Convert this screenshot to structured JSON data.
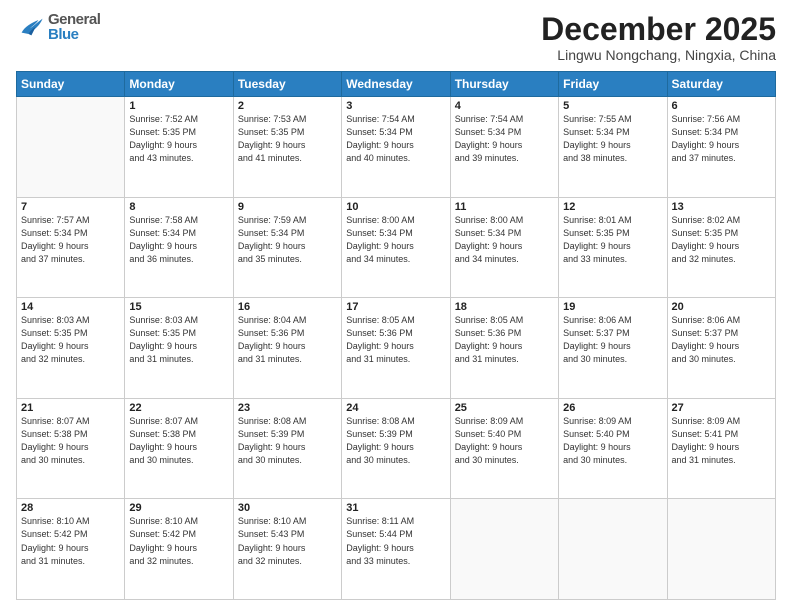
{
  "header": {
    "logo_line1": "General",
    "logo_line2": "Blue",
    "month_title": "December 2025",
    "location": "Lingwu Nongchang, Ningxia, China"
  },
  "calendar": {
    "weekdays": [
      "Sunday",
      "Monday",
      "Tuesday",
      "Wednesday",
      "Thursday",
      "Friday",
      "Saturday"
    ],
    "weeks": [
      [
        {
          "day": "",
          "info": ""
        },
        {
          "day": "1",
          "info": "Sunrise: 7:52 AM\nSunset: 5:35 PM\nDaylight: 9 hours\nand 43 minutes."
        },
        {
          "day": "2",
          "info": "Sunrise: 7:53 AM\nSunset: 5:35 PM\nDaylight: 9 hours\nand 41 minutes."
        },
        {
          "day": "3",
          "info": "Sunrise: 7:54 AM\nSunset: 5:34 PM\nDaylight: 9 hours\nand 40 minutes."
        },
        {
          "day": "4",
          "info": "Sunrise: 7:54 AM\nSunset: 5:34 PM\nDaylight: 9 hours\nand 39 minutes."
        },
        {
          "day": "5",
          "info": "Sunrise: 7:55 AM\nSunset: 5:34 PM\nDaylight: 9 hours\nand 38 minutes."
        },
        {
          "day": "6",
          "info": "Sunrise: 7:56 AM\nSunset: 5:34 PM\nDaylight: 9 hours\nand 37 minutes."
        }
      ],
      [
        {
          "day": "7",
          "info": "Sunrise: 7:57 AM\nSunset: 5:34 PM\nDaylight: 9 hours\nand 37 minutes."
        },
        {
          "day": "8",
          "info": "Sunrise: 7:58 AM\nSunset: 5:34 PM\nDaylight: 9 hours\nand 36 minutes."
        },
        {
          "day": "9",
          "info": "Sunrise: 7:59 AM\nSunset: 5:34 PM\nDaylight: 9 hours\nand 35 minutes."
        },
        {
          "day": "10",
          "info": "Sunrise: 8:00 AM\nSunset: 5:34 PM\nDaylight: 9 hours\nand 34 minutes."
        },
        {
          "day": "11",
          "info": "Sunrise: 8:00 AM\nSunset: 5:34 PM\nDaylight: 9 hours\nand 34 minutes."
        },
        {
          "day": "12",
          "info": "Sunrise: 8:01 AM\nSunset: 5:35 PM\nDaylight: 9 hours\nand 33 minutes."
        },
        {
          "day": "13",
          "info": "Sunrise: 8:02 AM\nSunset: 5:35 PM\nDaylight: 9 hours\nand 32 minutes."
        }
      ],
      [
        {
          "day": "14",
          "info": "Sunrise: 8:03 AM\nSunset: 5:35 PM\nDaylight: 9 hours\nand 32 minutes."
        },
        {
          "day": "15",
          "info": "Sunrise: 8:03 AM\nSunset: 5:35 PM\nDaylight: 9 hours\nand 31 minutes."
        },
        {
          "day": "16",
          "info": "Sunrise: 8:04 AM\nSunset: 5:36 PM\nDaylight: 9 hours\nand 31 minutes."
        },
        {
          "day": "17",
          "info": "Sunrise: 8:05 AM\nSunset: 5:36 PM\nDaylight: 9 hours\nand 31 minutes."
        },
        {
          "day": "18",
          "info": "Sunrise: 8:05 AM\nSunset: 5:36 PM\nDaylight: 9 hours\nand 31 minutes."
        },
        {
          "day": "19",
          "info": "Sunrise: 8:06 AM\nSunset: 5:37 PM\nDaylight: 9 hours\nand 30 minutes."
        },
        {
          "day": "20",
          "info": "Sunrise: 8:06 AM\nSunset: 5:37 PM\nDaylight: 9 hours\nand 30 minutes."
        }
      ],
      [
        {
          "day": "21",
          "info": "Sunrise: 8:07 AM\nSunset: 5:38 PM\nDaylight: 9 hours\nand 30 minutes."
        },
        {
          "day": "22",
          "info": "Sunrise: 8:07 AM\nSunset: 5:38 PM\nDaylight: 9 hours\nand 30 minutes."
        },
        {
          "day": "23",
          "info": "Sunrise: 8:08 AM\nSunset: 5:39 PM\nDaylight: 9 hours\nand 30 minutes."
        },
        {
          "day": "24",
          "info": "Sunrise: 8:08 AM\nSunset: 5:39 PM\nDaylight: 9 hours\nand 30 minutes."
        },
        {
          "day": "25",
          "info": "Sunrise: 8:09 AM\nSunset: 5:40 PM\nDaylight: 9 hours\nand 30 minutes."
        },
        {
          "day": "26",
          "info": "Sunrise: 8:09 AM\nSunset: 5:40 PM\nDaylight: 9 hours\nand 30 minutes."
        },
        {
          "day": "27",
          "info": "Sunrise: 8:09 AM\nSunset: 5:41 PM\nDaylight: 9 hours\nand 31 minutes."
        }
      ],
      [
        {
          "day": "28",
          "info": "Sunrise: 8:10 AM\nSunset: 5:42 PM\nDaylight: 9 hours\nand 31 minutes."
        },
        {
          "day": "29",
          "info": "Sunrise: 8:10 AM\nSunset: 5:42 PM\nDaylight: 9 hours\nand 32 minutes."
        },
        {
          "day": "30",
          "info": "Sunrise: 8:10 AM\nSunset: 5:43 PM\nDaylight: 9 hours\nand 32 minutes."
        },
        {
          "day": "31",
          "info": "Sunrise: 8:11 AM\nSunset: 5:44 PM\nDaylight: 9 hours\nand 33 minutes."
        },
        {
          "day": "",
          "info": ""
        },
        {
          "day": "",
          "info": ""
        },
        {
          "day": "",
          "info": ""
        }
      ]
    ]
  }
}
